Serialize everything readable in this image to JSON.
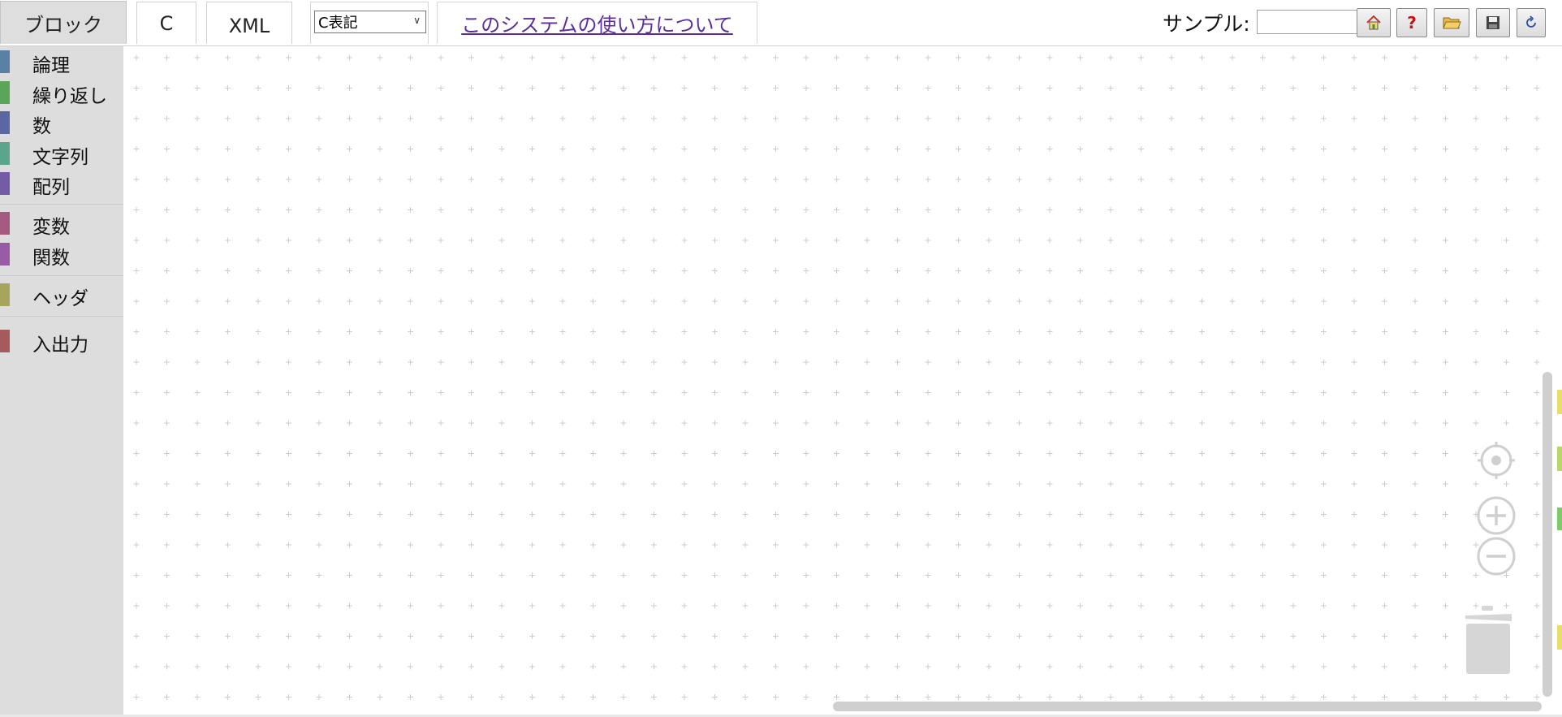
{
  "tabs": [
    {
      "label": "ブロック",
      "active": true
    },
    {
      "label": "C",
      "active": false
    },
    {
      "label": "XML",
      "active": false
    }
  ],
  "notation_select": {
    "value": "C表記"
  },
  "about_link": {
    "label": "このシステムの使い方について"
  },
  "sample": {
    "label": "サンプル:",
    "value": ""
  },
  "toolbar_icons": [
    "home-icon",
    "help-icon",
    "open-folder-icon",
    "save-icon",
    "reload-icon"
  ],
  "toolbox": {
    "categories": [
      {
        "label": "論理",
        "color": "#5b80a5"
      },
      {
        "label": "繰り返し",
        "color": "#5ba55b"
      },
      {
        "label": "数",
        "color": "#5b67a5"
      },
      {
        "label": "文字列",
        "color": "#5ba58c"
      },
      {
        "label": "配列",
        "color": "#745ba5"
      },
      {
        "label": "変数",
        "color": "#a55b80"
      },
      {
        "label": "関数",
        "color": "#995ba5"
      },
      {
        "label": "ヘッダ",
        "color": "#a5a55b"
      },
      {
        "label": "入出力",
        "color": "#a55b5b"
      }
    ]
  },
  "workspace_controls": [
    "recenter-icon",
    "zoom-in-icon",
    "zoom-out-icon",
    "trash-icon"
  ],
  "colors": {
    "toolbox_bg": "#dddddd",
    "link": "#5b2d9e",
    "grid": "#cccccc"
  }
}
